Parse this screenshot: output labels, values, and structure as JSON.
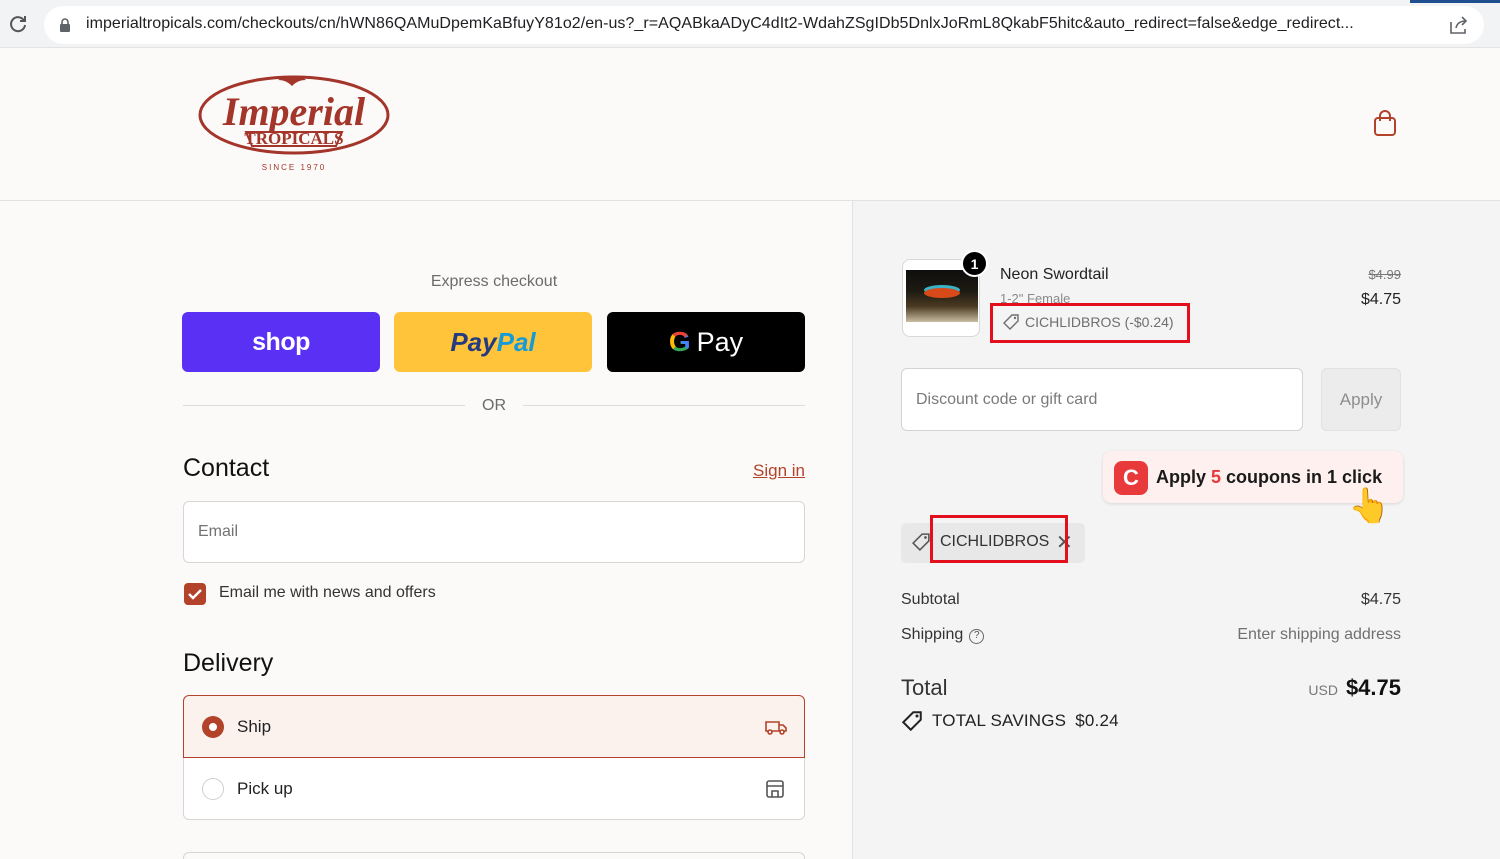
{
  "browser": {
    "url": "imperialtropicals.com/checkouts/cn/hWN86QAMuDpemKaBfuyY81o2/en-us?_r=AQABkaADyC4dIt2-WdahZSgIDb5DnlxJoRmL8QkabF5hitc&auto_redirect=false&edge_redirect..."
  },
  "header": {
    "logo_text": "Imperial",
    "logo_sub": "TROPICALS",
    "logo_since": "SINCE 1970"
  },
  "express": {
    "label": "Express checkout",
    "shop_label": "shop",
    "paypal_1": "Pay",
    "paypal_2": "Pal",
    "gpay_g": "G",
    "gpay_label": "Pay",
    "or_label": "OR"
  },
  "contact": {
    "title": "Contact",
    "signin": "Sign in",
    "email_placeholder": "Email",
    "news_label": "Email me with news and offers",
    "news_checked": true
  },
  "delivery": {
    "title": "Delivery",
    "options": [
      {
        "label": "Ship",
        "selected": true
      },
      {
        "label": "Pick up",
        "selected": false
      }
    ]
  },
  "order": {
    "product_name": "Neon Swordtail",
    "variant": "1-2\" Female",
    "quantity": "1",
    "old_price": "$4.99",
    "new_price": "$4.75",
    "discount_line": "CICHLIDBROS (-$0.24)",
    "discount_placeholder": "Discount code or gift card",
    "apply_label": "Apply",
    "coupon_pre": "Apply ",
    "coupon_num": "5",
    "coupon_post": " coupons in 1 click",
    "coupon_logo": "C",
    "code_chip": "CICHLIDBROS",
    "code_remove": "✕",
    "subtotal_label": "Subtotal",
    "subtotal_value": "$4.75",
    "shipping_label": "Shipping",
    "shipping_value": "Enter shipping address",
    "total_label": "Total",
    "currency": "USD",
    "total_value": "$4.75",
    "savings_label": "TOTAL SAVINGS",
    "savings_value": "$0.24"
  },
  "colors": {
    "accent": "#b2432a",
    "shop": "#5a31f4",
    "paypal": "#ffc439",
    "highlight": "#e30f1d"
  }
}
